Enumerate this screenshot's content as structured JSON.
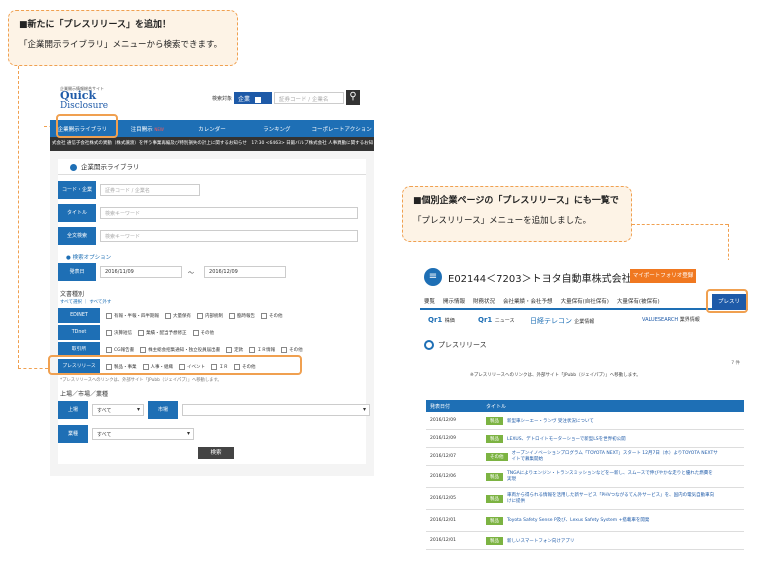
{
  "callout_left": {
    "heading": "■新たに「プレスリリース」を追加！",
    "text": "「企業開示ライブラリ」メニューから検索できます。"
  },
  "callout_right": {
    "heading": "■個別企業ページの「プレスリリース」にも一覧で",
    "text": "「プレスリリース」メニューを追加しました。"
  },
  "left": {
    "logo_small": "企業開示情報総合サイト",
    "logo_line1": "Quick",
    "logo_line2": "Disclosure",
    "search_label": "検索対象",
    "search_select": "企業",
    "search_placeholder": "証券コード / 企業名",
    "nav": [
      "企業開示ライブラリ",
      "注目開示",
      "カレンダー",
      "ランキング",
      "コーポレートアクション"
    ],
    "nav_badge": "NEW",
    "ticker": "式会社 通信子会社株式の異動（株式譲渡）を伴う事業再編及び特別損失の計上に関するお知らせ　17:30 <6463> 日鍛バルブ株式会社 人事異動に関するお知ら",
    "panel_title": "企業開示ライブラリ",
    "fields": [
      {
        "label": "コード・企業",
        "placeholder": "証券コード / 企業名"
      },
      {
        "label": "タイトル",
        "placeholder": "検索キーワード"
      },
      {
        "label": "全文検索",
        "placeholder": "検索キーワード"
      }
    ],
    "search_options": "検索オプション",
    "date_label": "発表日",
    "date_from": "2016/11/09",
    "date_sep": "〜",
    "date_to": "2016/12/09",
    "doc_type_title": "文書種別",
    "select_links": "すべて選択 ｜ すべて外す",
    "doc_rows": [
      {
        "label": "EDINET",
        "items": [
          "有報・半報・四半期報",
          "大量保有",
          "内部統制",
          "臨時報告",
          "その他"
        ]
      },
      {
        "label": "TDnet",
        "items": [
          "決算短信",
          "業績・配当予想修正",
          "その他"
        ]
      },
      {
        "label": "取引所",
        "items": [
          "CG報告書",
          "株主総会招集通知・独立役員届出書",
          "定款",
          "ＩＲ情報",
          "その他"
        ]
      },
      {
        "label": "プレスリリース",
        "items": [
          "製品・事業",
          "人事・組織",
          "イベント",
          "ＩＲ",
          "その他"
        ]
      }
    ],
    "note": "*プレスリリースへのリンクは、外部サイト「JPubb（ジェイパブ）」へ移動します。",
    "market_title": "上場／市場／業種",
    "market": [
      {
        "label": "上場",
        "value": "すべて"
      },
      {
        "label": "市場",
        "value": ""
      }
    ],
    "industry": {
      "label": "業種",
      "value": "すべて"
    },
    "search_button": "検索"
  },
  "right": {
    "title": "E02144＜7203＞トヨタ自動車株式会社",
    "portfolio_button": "マイポートフォリオ登録",
    "tabs": [
      "要覧",
      "開示情報",
      "財務状況",
      "会社業績・会社予想",
      "大量保有(自社保有)",
      "大量保有(被保有)"
    ],
    "active_tab": "プレスリリース",
    "logos": [
      "Qr1",
      "株価",
      "Qr1",
      "ニュース",
      "日経テレコン",
      "企業情報",
      "VALUESEARCH",
      "業界情報"
    ],
    "section": "プレスリリース",
    "count": "7 件",
    "note": "※プレスリリースへのリンクは、外部サイト「JPubb（ジェイパブ）」へ移動します。",
    "table_head": [
      "発表日付",
      "タイトル"
    ],
    "rows": [
      {
        "date": "2016/12/09",
        "badge": "製品",
        "title": "新型車シーエー・ランヴ 受注状況について"
      },
      {
        "date": "2016/12/09",
        "badge": "製品",
        "title": "LEXUS、デトロイトモーターショーで新型LSを世界初公開"
      },
      {
        "date": "2016/12/07",
        "badge": "その他",
        "title": "オープンイノベーションプログラム「TOYOTA NEXT」スタート 12月7日（水）よりTOYOTA NEXTサイトで募集開始"
      },
      {
        "date": "2016/12/06",
        "badge": "製品",
        "title": "TNGAによりエンジン・トランスミッションなどを一新し、スムースで伸びやかな走りと優れた燃費を実現"
      },
      {
        "date": "2016/12/05",
        "badge": "製品",
        "title": "車両から得られる情報を活用した新サービス「PHVつながるてん外サービス」を、国内の電気自動車向けに提供"
      },
      {
        "date": "2016/12/01",
        "badge": "製品",
        "title": "Toyota Safety Sense P及び、Lexus Safety System +搭載車を開発"
      },
      {
        "date": "2016/12/01",
        "badge": "製品",
        "title": "新しいスマートフォン向けアプリ"
      }
    ]
  },
  "colors": {
    "accent": "#1e6fb5",
    "highlight": "#f0a050",
    "orange_button": "#f07820",
    "badge_green": "#7cb342"
  }
}
